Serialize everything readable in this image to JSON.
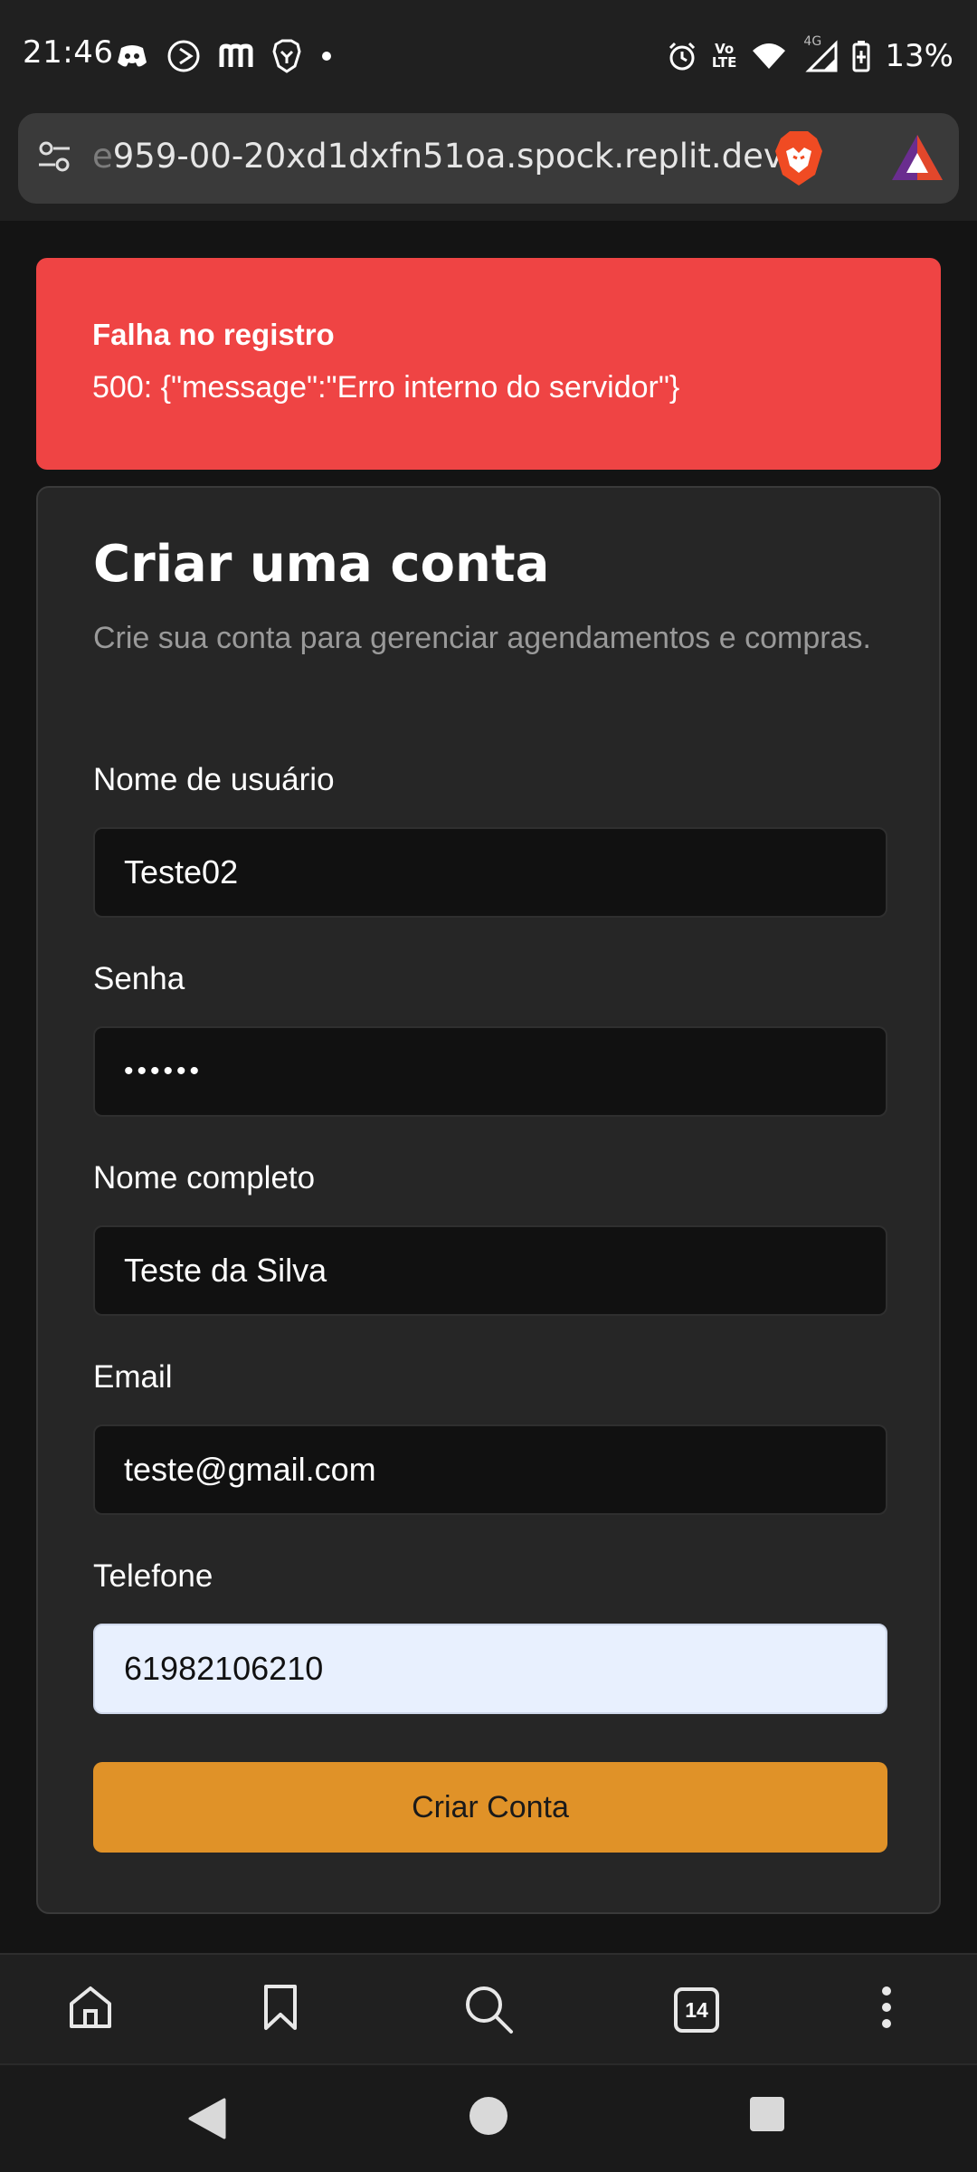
{
  "status_bar": {
    "time": "21:46",
    "battery": "13%",
    "network": "4G",
    "volte": "Vo LTE",
    "notification_icons": [
      "discord-icon",
      "play-icon",
      "m-app-icon",
      "brave-shield-icon",
      "dot-icon"
    ],
    "system_icons": [
      "alarm-icon",
      "volte-icon",
      "wifi-icon",
      "signal-icon",
      "battery-icon"
    ]
  },
  "browser": {
    "url_faded": "e",
    "url_text": "959-00-20xd1dxfn51oa.spock.replit.dev",
    "tab_count": "14",
    "toolbar_icons": [
      "home-icon",
      "bookmark-icon",
      "search-icon",
      "tabs-icon",
      "more-icon"
    ]
  },
  "alert": {
    "title": "Falha no registro",
    "message": "500: {\"message\":\"Erro interno do servidor\"}",
    "color": "#ef4444"
  },
  "form": {
    "title": "Criar uma conta",
    "subtitle": "Crie sua conta para gerenciar agendamentos e compras.",
    "fields": [
      {
        "label": "Nome de usuário",
        "value": "Teste02"
      },
      {
        "label": "Senha",
        "value": "••••••"
      },
      {
        "label": "Nome completo",
        "value": "Teste da Silva"
      },
      {
        "label": "Email",
        "value": "teste@gmail.com"
      },
      {
        "label": "Telefone",
        "value": "61982106210"
      }
    ],
    "submit_label": "Criar Conta",
    "accent_color": "#e09228"
  }
}
